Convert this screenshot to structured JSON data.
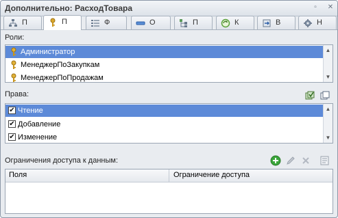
{
  "window": {
    "title": "Дополнительно: РасходТовара"
  },
  "tabs": [
    {
      "label": "П",
      "icon": "hierarchy-icon"
    },
    {
      "label": "П",
      "icon": "key-icon"
    },
    {
      "label": "Ф",
      "icon": "form-icon"
    },
    {
      "label": "О",
      "icon": "input-field-icon"
    },
    {
      "label": "П",
      "icon": "tree-icon"
    },
    {
      "label": "К",
      "icon": "refresh-icon"
    },
    {
      "label": "В",
      "icon": "import-icon"
    },
    {
      "label": "Н",
      "icon": "settings-gear-icon"
    }
  ],
  "roles": {
    "label": "Роли:",
    "items": [
      {
        "name": "Администратор",
        "selected": true
      },
      {
        "name": "МенеджерПоЗакупкам",
        "selected": false
      },
      {
        "name": "МенеджерПоПродажам",
        "selected": false
      }
    ]
  },
  "rights": {
    "label": "Права:",
    "items": [
      {
        "name": "Чтение",
        "checked": true,
        "selected": true
      },
      {
        "name": "Добавление",
        "checked": true,
        "selected": false
      },
      {
        "name": "Изменение",
        "checked": true,
        "selected": false
      }
    ]
  },
  "restrictions": {
    "label": "Ограничения доступа к данным:",
    "columns": [
      "Поля",
      "Ограничение доступа"
    ]
  },
  "colors": {
    "selection": "#5d8ad8",
    "add_green": "#3aa53a"
  }
}
